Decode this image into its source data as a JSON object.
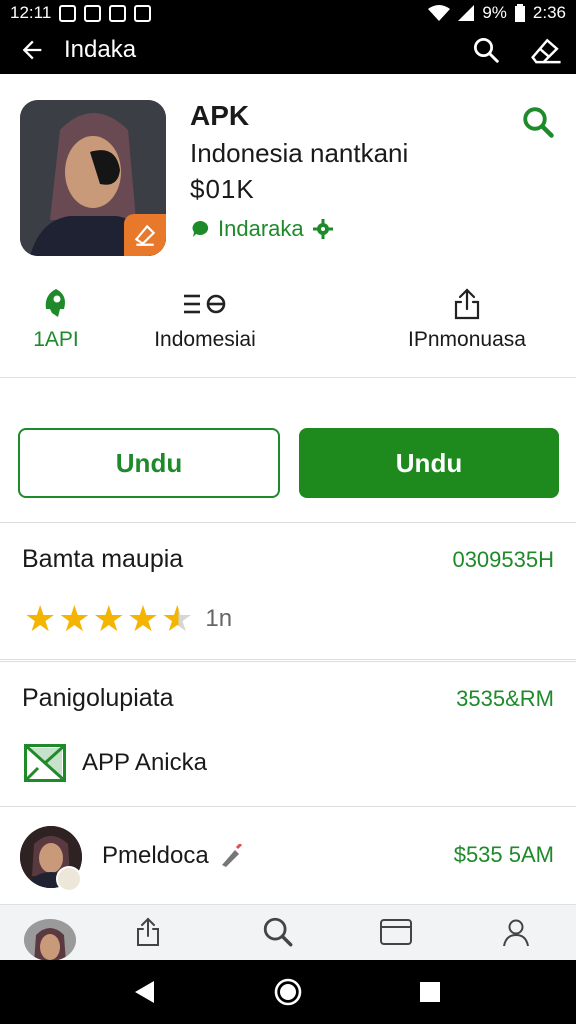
{
  "status_bar": {
    "time_left": "12:11",
    "battery": "9%",
    "time_right": "2:36"
  },
  "app_bar": {
    "title": "Indaka",
    "back_icon": "arrow-left-icon",
    "search_icon": "search-icon",
    "edit_icon": "edit-icon"
  },
  "app": {
    "name": "APK",
    "subtitle": "Indonesia nantkani",
    "size": "$01K",
    "developer": "Indaraka",
    "accent": "#1e8a2a",
    "badge_color": "#e8782a"
  },
  "info": [
    {
      "label": "1API",
      "icon": "rocket-icon"
    },
    {
      "label": "Indomesiai",
      "icon": "language-icon"
    },
    {
      "label": "IPnmonuasa",
      "icon": "share-icon"
    }
  ],
  "buttons": {
    "outline_label": "Undu",
    "filled_label": "Undu"
  },
  "rating": {
    "title": "Bamta maupia",
    "value": "0309535H",
    "stars": 4.5,
    "count": "1n"
  },
  "category": {
    "title": "Panigolupiata",
    "value": "3535&RM",
    "label": "APP Anicka",
    "icon": "category-icon"
  },
  "developer_row": {
    "name": "Pmeldoca",
    "time": "$535 5AM",
    "icon": "pen-icon"
  },
  "bottom_nav": [
    {
      "icon": "avatar"
    },
    {
      "icon": "share-icon"
    },
    {
      "icon": "search-icon"
    },
    {
      "icon": "card-icon"
    },
    {
      "icon": "person-icon"
    }
  ],
  "system_nav": [
    "back-icon",
    "home-icon",
    "recents-icon"
  ]
}
